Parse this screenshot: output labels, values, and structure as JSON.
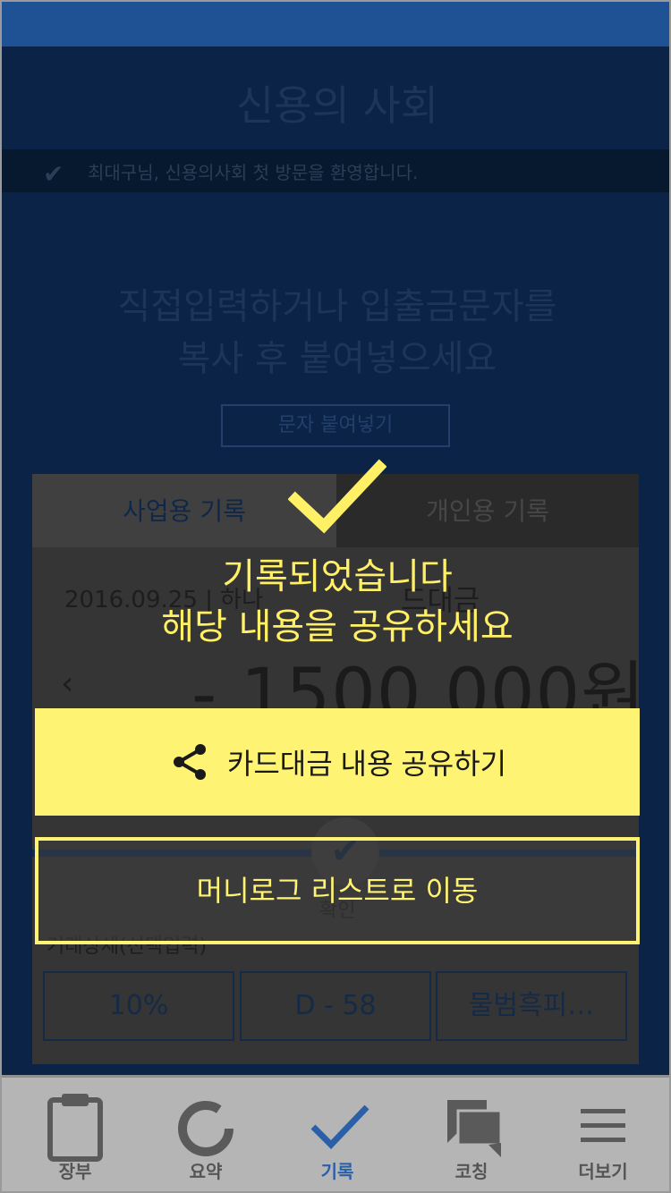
{
  "app": {
    "title": "신용의 사회"
  },
  "welcome": {
    "text": "최대구님, 신용의사회 첫 방문을 환영합니다."
  },
  "main": {
    "headline_line1": "직접입력하거나 입출금문자를",
    "headline_line2": "복사 후 붙여넣으세요",
    "paste_button": "문자 붙여넣기"
  },
  "record": {
    "tabs": [
      {
        "label": "사업용 기록"
      },
      {
        "label": "개인용 기록"
      }
    ],
    "date": "2016.09.25 | 하나",
    "description": "드대금",
    "amount": "- 1500,000원",
    "prev": "‹",
    "next": "›",
    "confirm_label": "확인",
    "detail_label": "거래상세(선택입력)",
    "chips": [
      {
        "label": "10%"
      },
      {
        "label": "D - 58"
      },
      {
        "label": "물범흑피…"
      }
    ]
  },
  "modal": {
    "message_line1": "기록되었습니다",
    "message_line2": "해당 내용을 공유하세요",
    "share_button": "카드대금 내용 공유하기",
    "list_button": "머니로그 리스트로 이동"
  },
  "tabbar": {
    "items": [
      {
        "label": "장부",
        "icon": "clipboard-icon"
      },
      {
        "label": "요약",
        "icon": "donut-icon"
      },
      {
        "label": "기록",
        "icon": "checkmark-icon"
      },
      {
        "label": "코칭",
        "icon": "chat-icon"
      },
      {
        "label": "더보기",
        "icon": "menu-icon"
      }
    ],
    "active_index": 2
  },
  "colors": {
    "accent_yellow": "#fff374",
    "background_navy": "#0a2347",
    "status_blue": "#1e5294",
    "active_tab_blue": "#2b5fa8"
  }
}
